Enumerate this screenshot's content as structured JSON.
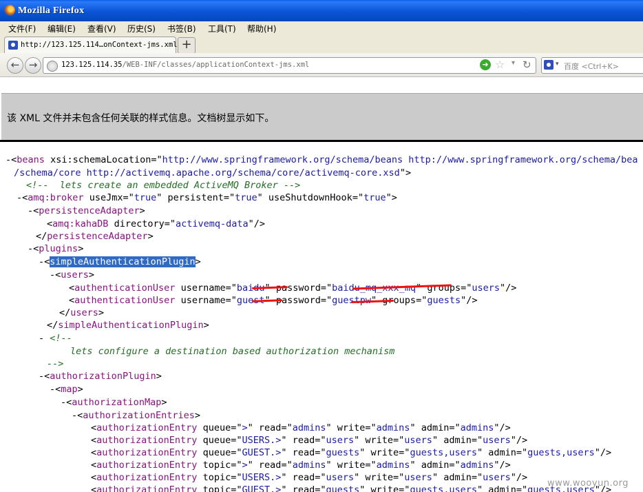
{
  "window": {
    "title": "Mozilla Firefox"
  },
  "menu": [
    {
      "label": "文件(F)"
    },
    {
      "label": "编辑(E)"
    },
    {
      "label": "查看(V)"
    },
    {
      "label": "历史(S)"
    },
    {
      "label": "书签(B)"
    },
    {
      "label": "工具(T)"
    },
    {
      "label": "帮助(H)"
    }
  ],
  "tab": {
    "label": "http://123.125.114…onContext-jms.xml",
    "new_tab": "+"
  },
  "nav": {
    "back": "←",
    "forward": "→",
    "url_host": "123.125.114.35",
    "url_path": "/WEB-INF/classes/applicationContext-jms.xml",
    "go": "➜",
    "bookmark": "☆",
    "dropdown": "▾",
    "reload": "↻",
    "search_placeholder": "百度 <Ctrl+K>",
    "search_dropdown": "▾"
  },
  "banner": {
    "message": "该 XML 文件并未包含任何关联的样式信息。文档树显示如下。"
  },
  "xml": {
    "l1_tag": "beans",
    "l1_attr": "xsi:schemaLocation",
    "l1_val_a": "http://www.springframework.org/schema/beans http://www.springframework.org/schema/bea",
    "l1_val_b": "/schema/core http://activemq.apache.org/schema/core/activemq-core.xsd",
    "c1": "<!--  lets create an embedded ActiveMQ Broker -->",
    "broker_tag": "amq:broker",
    "broker_a1": "useJmx",
    "broker_v1": "true",
    "broker_a2": "persistent",
    "broker_v2": "true",
    "broker_a3": "useShutdownHook",
    "broker_v3": "true",
    "pa_tag": "persistenceAdapter",
    "kaha_tag": "amq:kahaDB",
    "kaha_attr": "directory",
    "kaha_val": "activemq-data",
    "plugins_tag": "plugins",
    "sap_tag": "simpleAuthenticationPlugin",
    "users_tag": "users",
    "au_tag": "authenticationUser",
    "u1_user": "baidu",
    "u1_pass": "baidu_mq_xxx_mq",
    "u1_groups": "users",
    "u2_user": "guest",
    "u2_pass": "guestpw",
    "u2_groups": "guests",
    "attr_username": "username",
    "attr_password": "password",
    "attr_groups": "groups",
    "c2_open": "<!--",
    "c2_text": "lets configure a destination based authorization mechanism",
    "c2_close": "-->",
    "azp_tag": "authorizationPlugin",
    "map_tag": "map",
    "azmap_tag": "authorizationMap",
    "aze_tag": "authorizationEntries",
    "entry_tag": "authorizationEntry",
    "attr_queue": "queue",
    "attr_topic": "topic",
    "attr_read": "read",
    "attr_write": "write",
    "attr_admin": "admin",
    "entries": [
      {
        "kind": "queue",
        "name": ">",
        "read": "admins",
        "write": "admins",
        "admin": "admins"
      },
      {
        "kind": "queue",
        "name": "USERS.>",
        "read": "users",
        "write": "users",
        "admin": "users"
      },
      {
        "kind": "queue",
        "name": "GUEST.>",
        "read": "guests",
        "write": "guests,users",
        "admin": "guests,users"
      },
      {
        "kind": "topic",
        "name": ">",
        "read": "admins",
        "write": "admins",
        "admin": "admins"
      },
      {
        "kind": "topic",
        "name": "USERS.>",
        "read": "users",
        "write": "users",
        "admin": "users"
      },
      {
        "kind": "topic",
        "name": "GUEST.>",
        "read": "guests",
        "write": "guests,users",
        "admin": "guests,users"
      }
    ]
  },
  "watermark": "www.wooyun.org"
}
